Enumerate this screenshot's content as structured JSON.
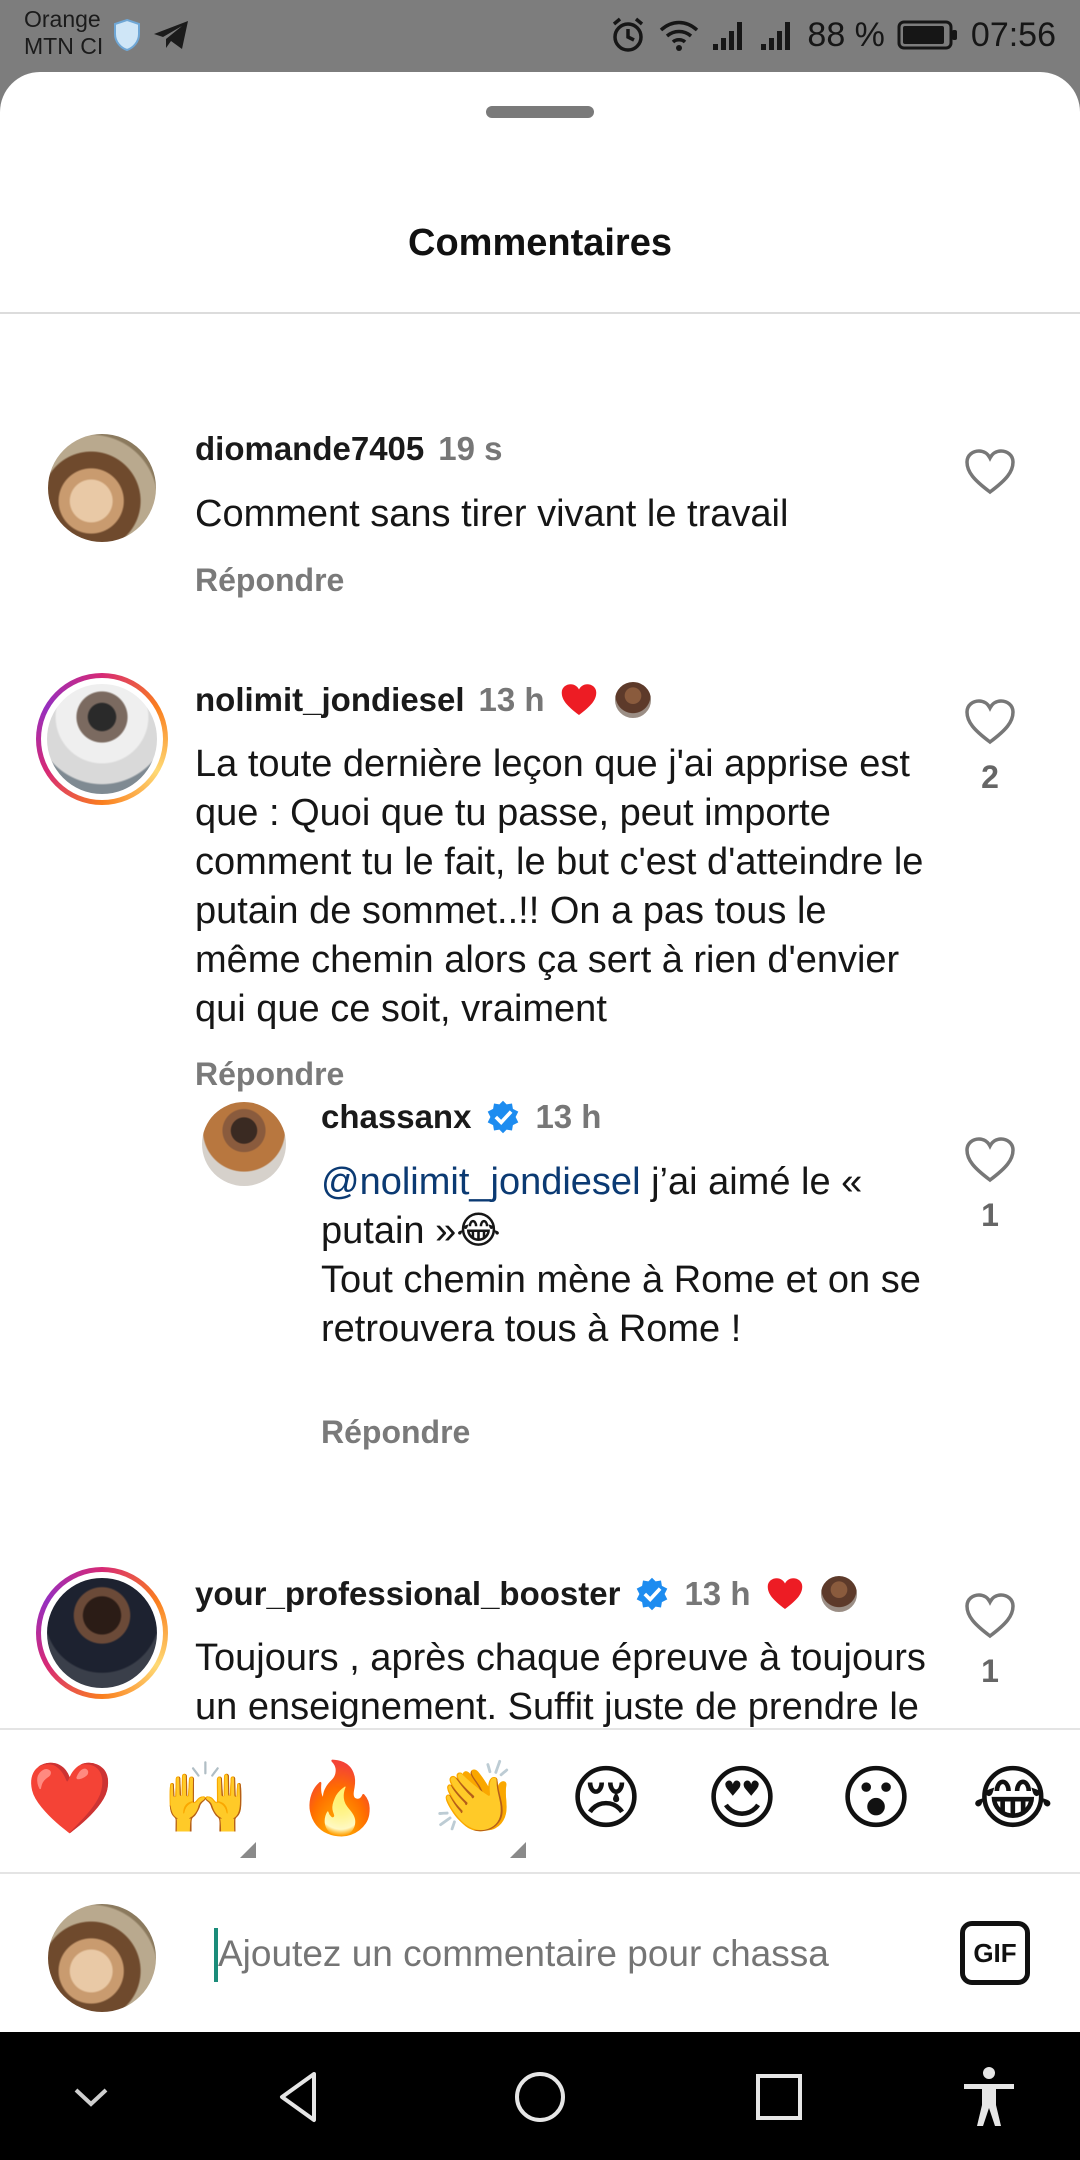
{
  "status_bar": {
    "carrier_line1": "Orange",
    "carrier_line2": "MTN CI",
    "battery": "88 %",
    "time": "07:56"
  },
  "sheet": {
    "title": "Commentaires"
  },
  "comments": [
    {
      "username": "diomande7405",
      "time": "19 s",
      "text": "Comment sans tirer vivant le travail",
      "reply_label": "Répondre",
      "likes": ""
    },
    {
      "username": "nolimit_jondiesel",
      "time": "13 h",
      "text": "La toute dernière leçon que j'ai apprise est que : Quoi que tu passe, peut importe comment tu le fait, le but c'est d'atteindre le putain de sommet..!! On a pas tous le même chemin alors ça sert à rien d'envier qui que ce soit, vraiment",
      "reply_label": "Répondre",
      "likes": "2"
    },
    {
      "username": "chassanx",
      "time": "13 h",
      "mention": "@nolimit_jondiesel",
      "text_after_mention": " j’ai aimé le « putain »😂",
      "text_line2": "Tout chemin mène à Rome et on se retrouvera tous à Rome !",
      "reply_label": "Répondre",
      "likes": "1"
    },
    {
      "username": "your_professional_booster",
      "time": "13 h",
      "text": "Toujours , après chaque épreuve à toujours un enseignement. Suffit juste de prendre le recul pour le voir afin de",
      "likes": "1"
    }
  ],
  "emoji_bar": [
    "❤️",
    "🙌",
    "🔥",
    "👏",
    "😢",
    "😍",
    "😮",
    "😂"
  ],
  "input": {
    "placeholder": "Ajoutez un commentaire pour chassa",
    "gif_label": "GIF"
  },
  "icons": {
    "heart": "heart-icon",
    "verified": "verified-badge-icon",
    "red_heart": "creator-liked-heart-icon"
  },
  "colors": {
    "like_red": "#ed1c24",
    "verified_blue": "#1d8cf0",
    "mention_blue": "#0b3a73"
  }
}
